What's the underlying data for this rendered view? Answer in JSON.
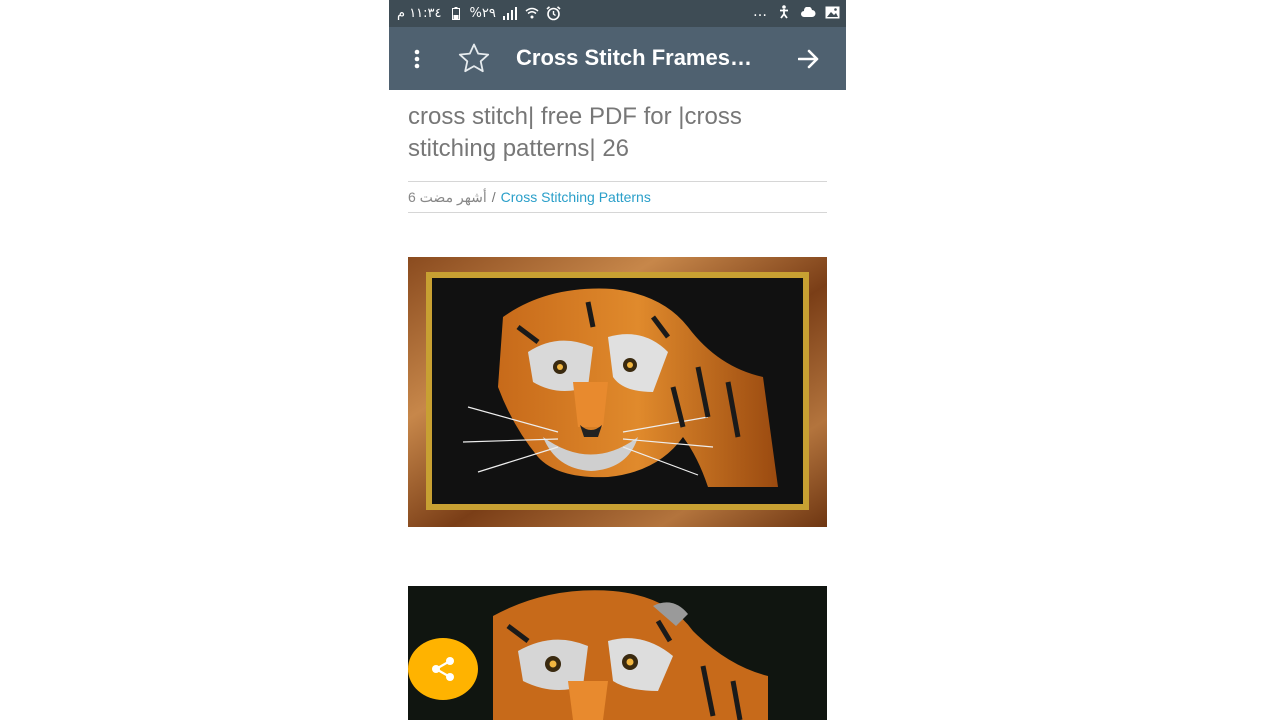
{
  "status_bar": {
    "time": "١١:٣٤ م",
    "battery": "%٢٩",
    "icons_right": [
      "more-notifications",
      "accessibility-icon",
      "cloud-icon",
      "image-icon"
    ],
    "icons_left": [
      "battery-icon",
      "signal-icon",
      "wifi-icon",
      "alarm-icon"
    ]
  },
  "app_bar": {
    "title": "Cross Stitch Frames…",
    "background": "#4f6170"
  },
  "post": {
    "title": "cross stitch| free PDF for |cross stitching patterns| 26",
    "date": "أشهر مضت 6",
    "separator": "/",
    "category": "Cross Stitching Patterns"
  },
  "colors": {
    "status_bar": "#3e4c55",
    "accent_link": "#2a9fc9",
    "fab": "#ffb300"
  }
}
